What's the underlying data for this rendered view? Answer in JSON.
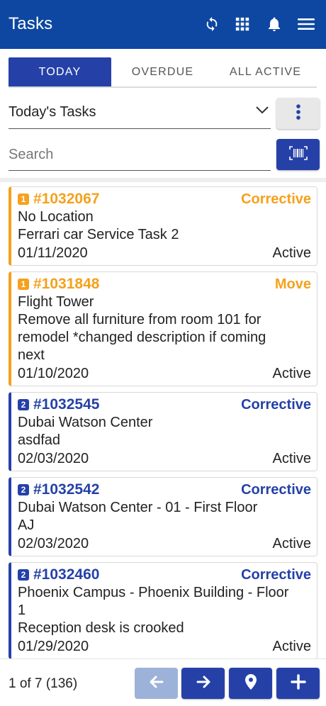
{
  "app": {
    "title": "Tasks"
  },
  "header_icons": [
    "sync-icon",
    "grid-icon",
    "bell-icon",
    "menu-icon"
  ],
  "colors": {
    "primary": "#2541a8",
    "appbar": "#0d47a1",
    "priority1": "#f5a11c",
    "priority2": "#2541a8"
  },
  "tabs": [
    {
      "label": "TODAY",
      "active": true
    },
    {
      "label": "OVERDUE",
      "active": false
    },
    {
      "label": "ALL ACTIVE",
      "active": false
    }
  ],
  "filter": {
    "selected": "Today's Tasks"
  },
  "search": {
    "placeholder": "Search"
  },
  "tasks": [
    {
      "priority": "1",
      "id": "#1032067",
      "type": "Corrective",
      "lines": [
        "No Location",
        "Ferrari car Service Task 2"
      ],
      "date": "01/11/2020",
      "status": "Active"
    },
    {
      "priority": "1",
      "id": "#1031848",
      "type": "Move",
      "lines": [
        "Flight Tower",
        "Remove all furniture from room 101 for",
        "remodel *changed description if coming",
        "next"
      ],
      "date": "01/10/2020",
      "status": "Active"
    },
    {
      "priority": "2",
      "id": "#1032545",
      "type": "Corrective",
      "lines": [
        "Dubai Watson Center",
        "asdfad"
      ],
      "date": "02/03/2020",
      "status": "Active"
    },
    {
      "priority": "2",
      "id": "#1032542",
      "type": "Corrective",
      "lines": [
        "Dubai Watson Center - 01 - First Floor",
        "AJ"
      ],
      "date": "02/03/2020",
      "status": "Active"
    },
    {
      "priority": "2",
      "id": "#1032460",
      "type": "Corrective",
      "lines": [
        "Phoenix Campus - Phoenix Building - Floor",
        "1",
        "Reception desk is crooked"
      ],
      "date": "01/29/2020",
      "status": "Active"
    }
  ],
  "pager": {
    "text": "1 of 7 (136)"
  }
}
